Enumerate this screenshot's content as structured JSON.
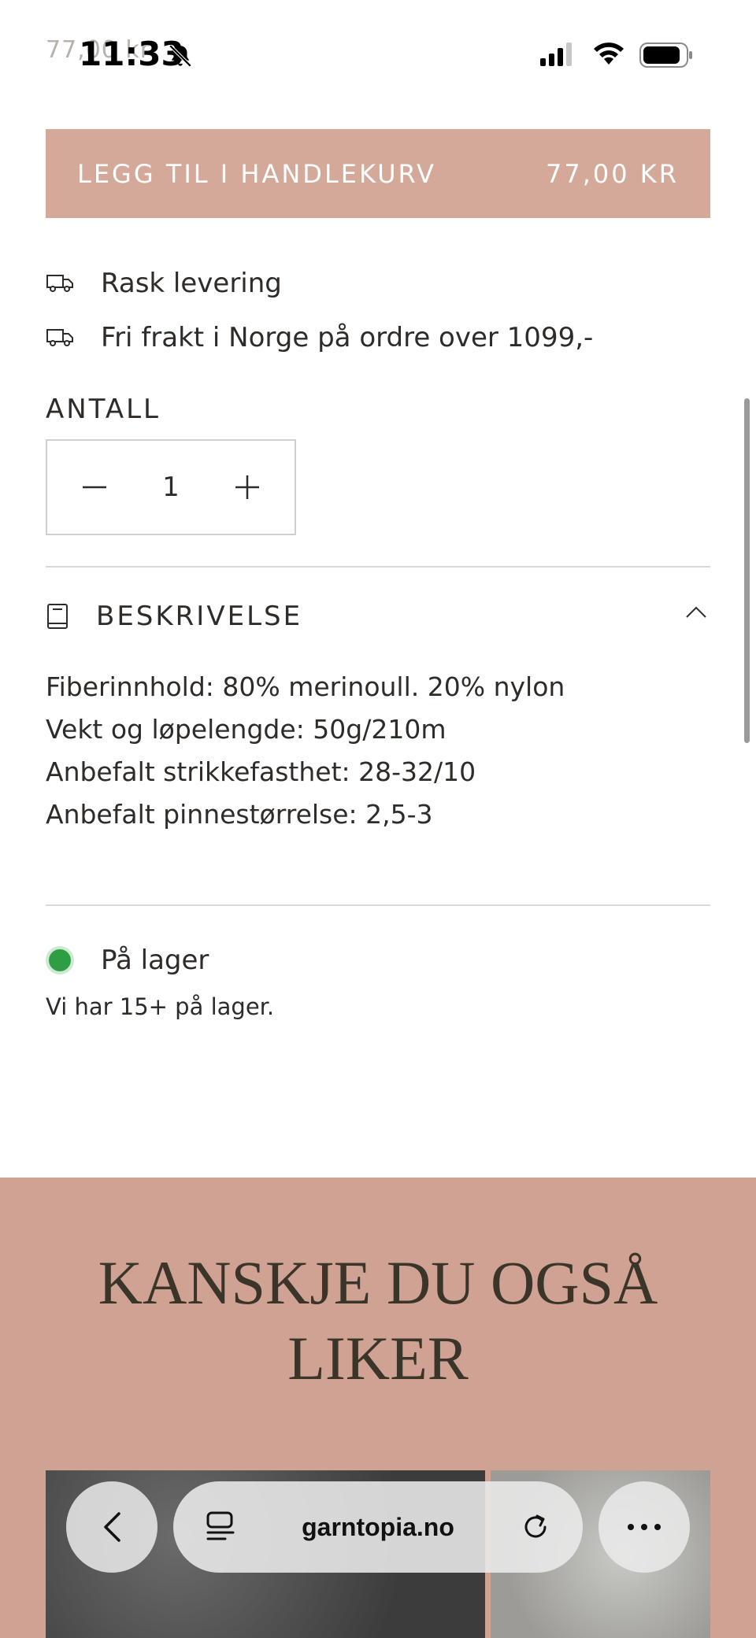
{
  "status_bar": {
    "time": "11:33",
    "behind_price": "77,00 kr"
  },
  "cart": {
    "label": "LEGG TIL I HANDLEKURV",
    "price": "77,00 KR"
  },
  "features": [
    {
      "icon": "truck-icon",
      "text": "Rask levering"
    },
    {
      "icon": "truck-icon",
      "text": "Fri frakt i Norge på ordre over 1099,-"
    }
  ],
  "quantity": {
    "label": "ANTALL",
    "value": "1"
  },
  "description": {
    "title": "BESKRIVELSE",
    "lines": [
      "Fiberinnhold: 80% merinoull. 20% nylon",
      "Vekt og løpelengde: 50g/210m",
      "Anbefalt strikkefasthet: 28-32/10",
      "Anbefalt pinnestørrelse: 2,5-3"
    ]
  },
  "stock": {
    "status": "På lager",
    "note": "Vi har 15+ på lager.",
    "color": "#2e9e44"
  },
  "recommendations": {
    "title_line1": "KANSKJE DU OGSÅ",
    "title_line2": "LIKER",
    "background": "#cfa294"
  },
  "browser": {
    "url": "garntopia.no"
  },
  "colors": {
    "accent": "#d4a99a",
    "text": "#2f2b28"
  }
}
